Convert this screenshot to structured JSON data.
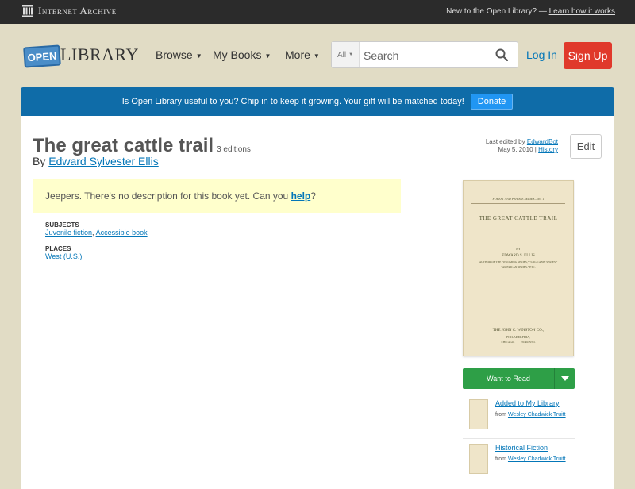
{
  "ia_bar": {
    "logo_text": "Internet Archive",
    "new_text": "New to the Open Library? —",
    "learn_link": "Learn how it works"
  },
  "header": {
    "logo_open": "OPEN",
    "logo_library": "LIBRARY",
    "nav": [
      {
        "label": "Browse"
      },
      {
        "label": "My Books"
      },
      {
        "label": "More"
      }
    ],
    "search": {
      "scope": "All",
      "placeholder": "Search"
    },
    "login_label": "Log In",
    "signup_label": "Sign Up"
  },
  "donate": {
    "message": "Is Open Library useful to you? Chip in to keep it growing. Your gift will be matched today!",
    "button_label": "Donate"
  },
  "work": {
    "title": "The great cattle trail",
    "editions": "3 editions",
    "by_prefix": "By",
    "author": "Edward Sylvester Ellis",
    "last_edited_prefix": "Last edited by",
    "last_edited_by": "EdwardBot",
    "last_edited_date": "May 5, 2010 |",
    "history_link": "History",
    "edit_label": "Edit",
    "description_text": "Jeepers. There's no description for this book yet. Can you",
    "description_help": "help",
    "description_end": "?",
    "subjects_head": "Subjects",
    "subjects": [
      "Juvenile fiction",
      "Accessible book"
    ],
    "places_head": "Places",
    "places": [
      "West (U.S.)"
    ]
  },
  "cover": {
    "series": "FOREST AND PRAIRIE SERIES—No. 1",
    "title": "THE GREAT CATTLE TRAIL",
    "by": "BY",
    "author": "EDWARD S. ELLIS",
    "line1": "AUTHOR OF THE \"WYOMING SERIES,\" \"LOG CABIN SERIES,\"",
    "line2": "\"AMERICAN SERIES,\" ETC.",
    "publisher": "THE JOHN C. WINSTON CO.,",
    "city": "PHILADELPHIA,",
    "cities2": "CHICAGO,          TORONTO."
  },
  "sidebar": {
    "want_label": "Want to Read",
    "lists": [
      {
        "title": "Added to My Library",
        "from": "from",
        "owner": "Wesley Chadwick Truitt"
      },
      {
        "title": "Historical Fiction",
        "from": "from",
        "owner": "Wesley Chadwick Truitt"
      }
    ]
  }
}
